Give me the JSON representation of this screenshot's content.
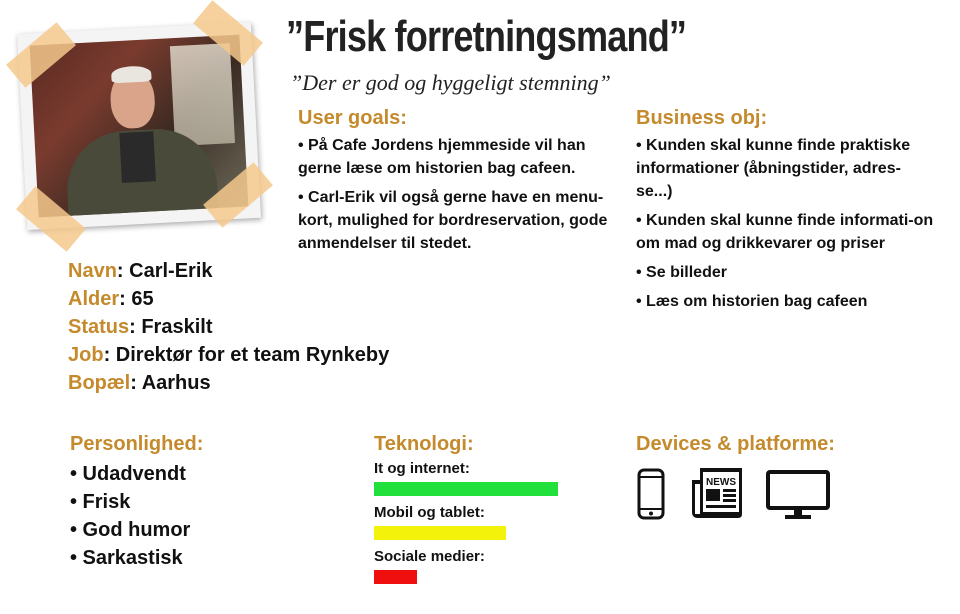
{
  "header": {
    "title": "”Frisk forretningsmand”",
    "quote": "”Der er god og hyggeligt stemning”"
  },
  "user_goals": {
    "heading": "User goals:",
    "items": [
      "• På Cafe Jordens hjemmeside vil han gerne læse om historien bag cafeen.",
      "• Carl-Erik vil også gerne have en menu-kort, mulighed for bordreservation, gode anmendelser til stedet."
    ]
  },
  "business": {
    "heading": "Business obj:",
    "items": [
      "• Kunden skal kunne finde praktiske informationer (åbningstider, adres-se...)",
      "• Kunden skal kunne finde informati-on om mad og drikkevarer og priser",
      "• Se billeder",
      "• Læs om historien bag cafeen"
    ]
  },
  "facts": [
    {
      "label": "Navn",
      "value": ": Carl-Erik"
    },
    {
      "label": "Alder",
      "value": ": 65"
    },
    {
      "label": "Status",
      "value": ": Fraskilt"
    },
    {
      "label": "Job",
      "value": ": Direktør for et team Rynkeby"
    },
    {
      "label": "Bopæl",
      "value": ": Aarhus"
    }
  ],
  "personality": {
    "heading": "Personlighed:",
    "items": [
      "• Udadvendt",
      "• Frisk",
      "• God humor",
      "• Sarkastisk"
    ]
  },
  "technology": {
    "heading": "Teknologi:",
    "items": [
      {
        "label": "It og internet:",
        "level": 0.85,
        "color": "#22e03c"
      },
      {
        "label": "Mobil og tablet:",
        "level": 0.61,
        "color": "#f2f20a"
      },
      {
        "label": "Sociale medier:",
        "level": 0.2,
        "color": "#ef0f0f"
      }
    ]
  },
  "devices": {
    "heading": "Devices & platforme:",
    "icons": [
      "smartphone-icon",
      "newspaper-icon",
      "monitor-icon"
    ],
    "news_label": "NEWS"
  },
  "colors": {
    "accent": "#c48a2c"
  }
}
